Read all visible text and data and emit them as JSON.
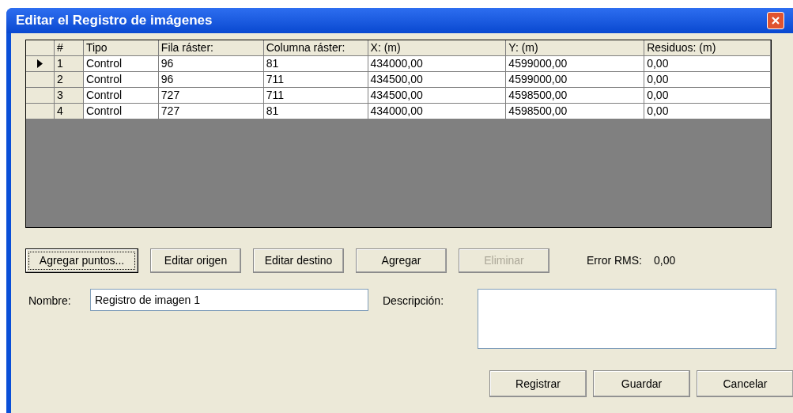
{
  "window": {
    "title": "Editar el Registro de imágenes"
  },
  "table": {
    "columns": [
      "#",
      "Tipo",
      "Fila ráster:",
      "Columna ráster:",
      "X: (m)",
      "Y: (m)",
      "Residuos: (m)"
    ],
    "rows": [
      {
        "selected": true,
        "cells": [
          "1",
          "Control",
          "96",
          "81",
          "434000,00",
          "4599000,00",
          "0,00"
        ]
      },
      {
        "selected": false,
        "cells": [
          "2",
          "Control",
          "96",
          "711",
          "434500,00",
          "4599000,00",
          "0,00"
        ]
      },
      {
        "selected": false,
        "cells": [
          "3",
          "Control",
          "727",
          "711",
          "434500,00",
          "4598500,00",
          "0,00"
        ]
      },
      {
        "selected": false,
        "cells": [
          "4",
          "Control",
          "727",
          "81",
          "434000,00",
          "4598500,00",
          "0,00"
        ]
      }
    ]
  },
  "actions": [
    {
      "label": "Agregar puntos...",
      "focused": true,
      "disabled": false
    },
    {
      "label": "Editar origen",
      "focused": false,
      "disabled": false
    },
    {
      "label": "Editar destino",
      "focused": false,
      "disabled": false
    },
    {
      "label": "Agregar",
      "focused": false,
      "disabled": false
    },
    {
      "label": "Eliminar",
      "focused": false,
      "disabled": true
    }
  ],
  "rms": {
    "label": "Error RMS:",
    "value": "0,00"
  },
  "name_field": {
    "label": "Nombre:",
    "value": "Registro de imagen 1"
  },
  "description_field": {
    "label": "Descripción:"
  },
  "buttons": [
    "Registrar",
    "Guardar",
    "Cancelar"
  ]
}
